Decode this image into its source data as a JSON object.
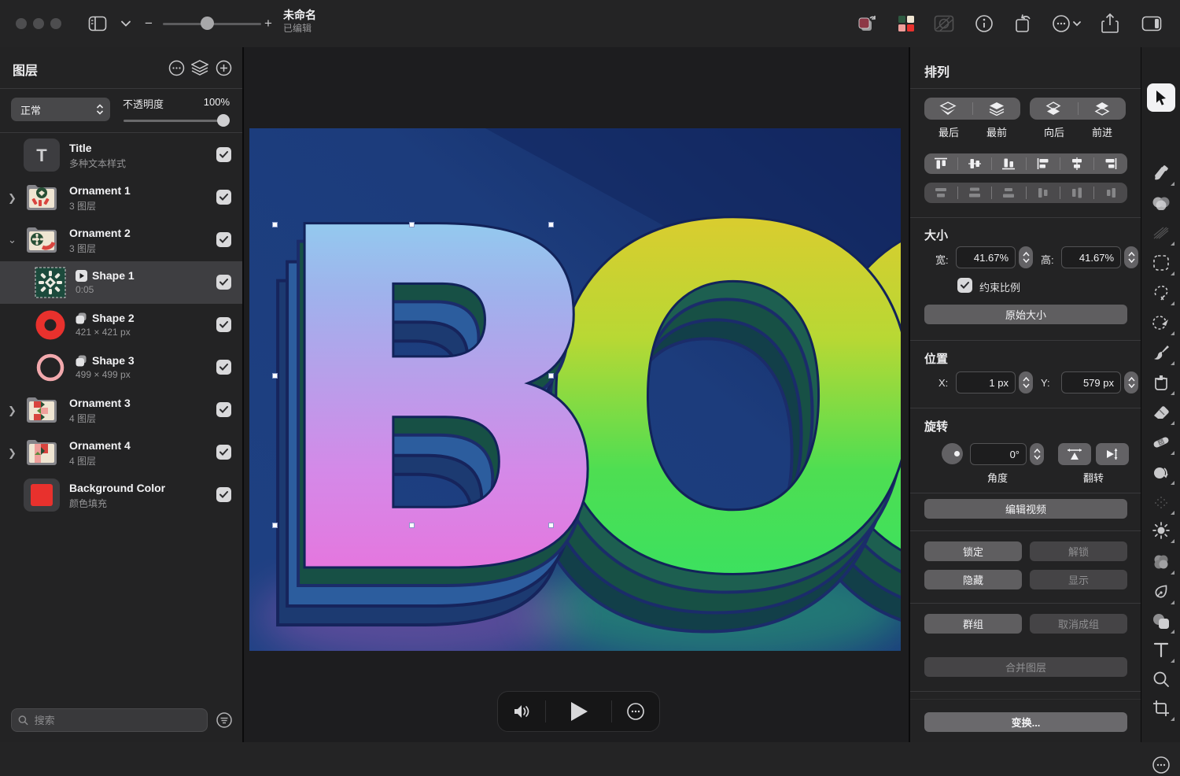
{
  "window": {
    "title": "未命名",
    "status": "已编辑"
  },
  "toolbar": {
    "left_icons": [
      "sidebar-toggle",
      "chevron-down",
      "zoom-out",
      "zoom-slider",
      "zoom-in"
    ],
    "zoom_out": "−",
    "zoom_in": "+",
    "right_icons": [
      "swap-colors",
      "color-palette",
      "image-adjust-disabled",
      "info",
      "rotate-canvas",
      "more-options",
      "share",
      "inspector-toggle"
    ],
    "palette_colors": [
      "#2d5940",
      "#efe5d2",
      "#ef9f9b",
      "#e8312d"
    ]
  },
  "layers_panel": {
    "title": "图层",
    "header_icons": [
      "more-circle",
      "isolate-icon",
      "add-circle"
    ],
    "blend_mode": "正常",
    "opacity_label": "不透明度",
    "opacity_value": "100%",
    "search_placeholder": "搜索",
    "items": [
      {
        "name": "Title",
        "meta": "多种文本样式",
        "type": "text",
        "checked": true
      },
      {
        "name": "Ornament 1",
        "meta": "3 图层",
        "type": "group",
        "expanded": false,
        "checked": true
      },
      {
        "name": "Ornament 2",
        "meta": "3 图层",
        "type": "group",
        "expanded": true,
        "checked": true
      },
      {
        "name": "Shape 1",
        "meta": "0:05",
        "type": "video",
        "selected": true,
        "checked": true
      },
      {
        "name": "Shape 2",
        "meta": "421 × 421 px",
        "type": "shape",
        "checked": true
      },
      {
        "name": "Shape 3",
        "meta": "499 × 499 px",
        "type": "shape",
        "checked": true
      },
      {
        "name": "Ornament 3",
        "meta": "4 图层",
        "type": "group",
        "expanded": false,
        "checked": true
      },
      {
        "name": "Ornament 4",
        "meta": "4 图层",
        "type": "group",
        "expanded": false,
        "checked": true
      },
      {
        "name": "Background Color",
        "meta": "颜色填充",
        "type": "fill",
        "fill_color": "#e8312d",
        "checked": true
      }
    ]
  },
  "arrange_panel": {
    "title": "排列",
    "order_labels": {
      "back": "最后",
      "front": "最前",
      "backward": "向后",
      "forward": "前进"
    },
    "size": {
      "label": "大小",
      "width_label": "宽:",
      "width_value": "41.67%",
      "height_label": "高:",
      "height_value": "41.67%",
      "constrain_label": "约束比例",
      "constrain_checked": true,
      "original_size_label": "原始大小"
    },
    "position": {
      "label": "位置",
      "x_label": "X:",
      "x_value": "1 px",
      "y_label": "Y:",
      "y_value": "579 px"
    },
    "rotation": {
      "label": "旋转",
      "angle_value": "0°",
      "angle_label": "角度",
      "flip_label": "翻转"
    },
    "buttons": {
      "edit_video": "编辑视频",
      "lock": "锁定",
      "unlock": "解锁",
      "hide": "隐藏",
      "show": "显示",
      "group": "群组",
      "ungroup": "取消成组",
      "merge_layers": "合并图层",
      "transform": "变换..."
    }
  },
  "canvas": {
    "letters": [
      "B",
      "O",
      "O"
    ],
    "background_color": "#1d3f80",
    "b_gradient": [
      "#84e8f2",
      "#9fb2ec",
      "#d489e8",
      "#f06ad8"
    ],
    "o_gradient": [
      "#f2c42b",
      "#b8d834",
      "#4ede52",
      "#2fe368"
    ],
    "extrusion_colors": [
      "#123f49",
      "#175045",
      "#1d5f50"
    ],
    "selection_handle_color": "#ffffff"
  },
  "playback": {
    "icons": [
      "volume",
      "play",
      "more"
    ]
  },
  "tools": [
    "select",
    "style",
    "color",
    "sketch",
    "marquee",
    "cut-out",
    "smart-select",
    "brush",
    "fill",
    "eraser",
    "heal",
    "clone",
    "grain",
    "adjust",
    "blur",
    "pen",
    "shapes",
    "text",
    "zoom",
    "crop",
    "more"
  ]
}
